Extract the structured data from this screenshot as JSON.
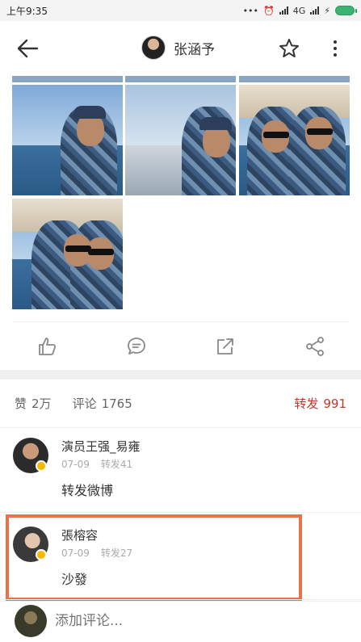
{
  "status_bar": {
    "time": "上午9:35",
    "dots": "•••",
    "network": "4G"
  },
  "header": {
    "title": "张涵予"
  },
  "stats": {
    "likes_label": "赞",
    "likes_count": "2万",
    "comments_label": "评论",
    "comments_count": "1765",
    "reposts_label": "转发",
    "reposts_count": "991"
  },
  "comments": [
    {
      "name": "演员王强_易雍",
      "date": "07-09",
      "reposts": "转发41",
      "text": "转发微博"
    },
    {
      "name": "張榕容",
      "date": "07-09",
      "reposts": "转发27",
      "text": "沙發"
    }
  ],
  "add_comment": {
    "placeholder": "添加评论..."
  },
  "colors": {
    "accent_red": "#c0392b",
    "highlight_orange": "#e8734a",
    "verified_badge": "#f6b800"
  }
}
